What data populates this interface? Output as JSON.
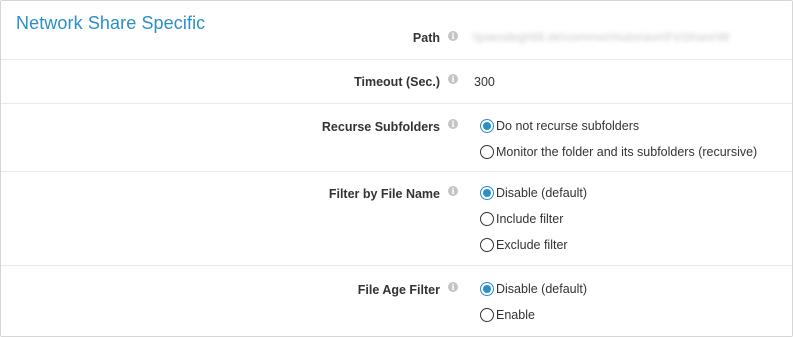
{
  "section": {
    "title": "Network Share Specific"
  },
  "fields": {
    "path": {
      "label": "Path",
      "value": "\\\\paesdegh66.de\\common\\hubs\\ave\\Fs\\Share\\W"
    },
    "timeout": {
      "label": "Timeout (Sec.)",
      "value": "300"
    },
    "recurse": {
      "label": "Recurse Subfolders",
      "options": [
        "Do not recurse subfolders",
        "Monitor the folder and its subfolders (recursive)"
      ],
      "selected": "Do not recurse subfolders"
    },
    "filter_name": {
      "label": "Filter by File Name",
      "options": [
        "Disable (default)",
        "Include filter",
        "Exclude filter"
      ],
      "selected": "Disable (default)"
    },
    "file_age": {
      "label": "File Age Filter",
      "options": [
        "Disable (default)",
        "Enable"
      ],
      "selected": "Disable (default)"
    }
  },
  "icons": {
    "info": "info-icon"
  },
  "colors": {
    "accent": "#2b8fc7",
    "border": "#d6d6d6",
    "label": "#333333"
  }
}
